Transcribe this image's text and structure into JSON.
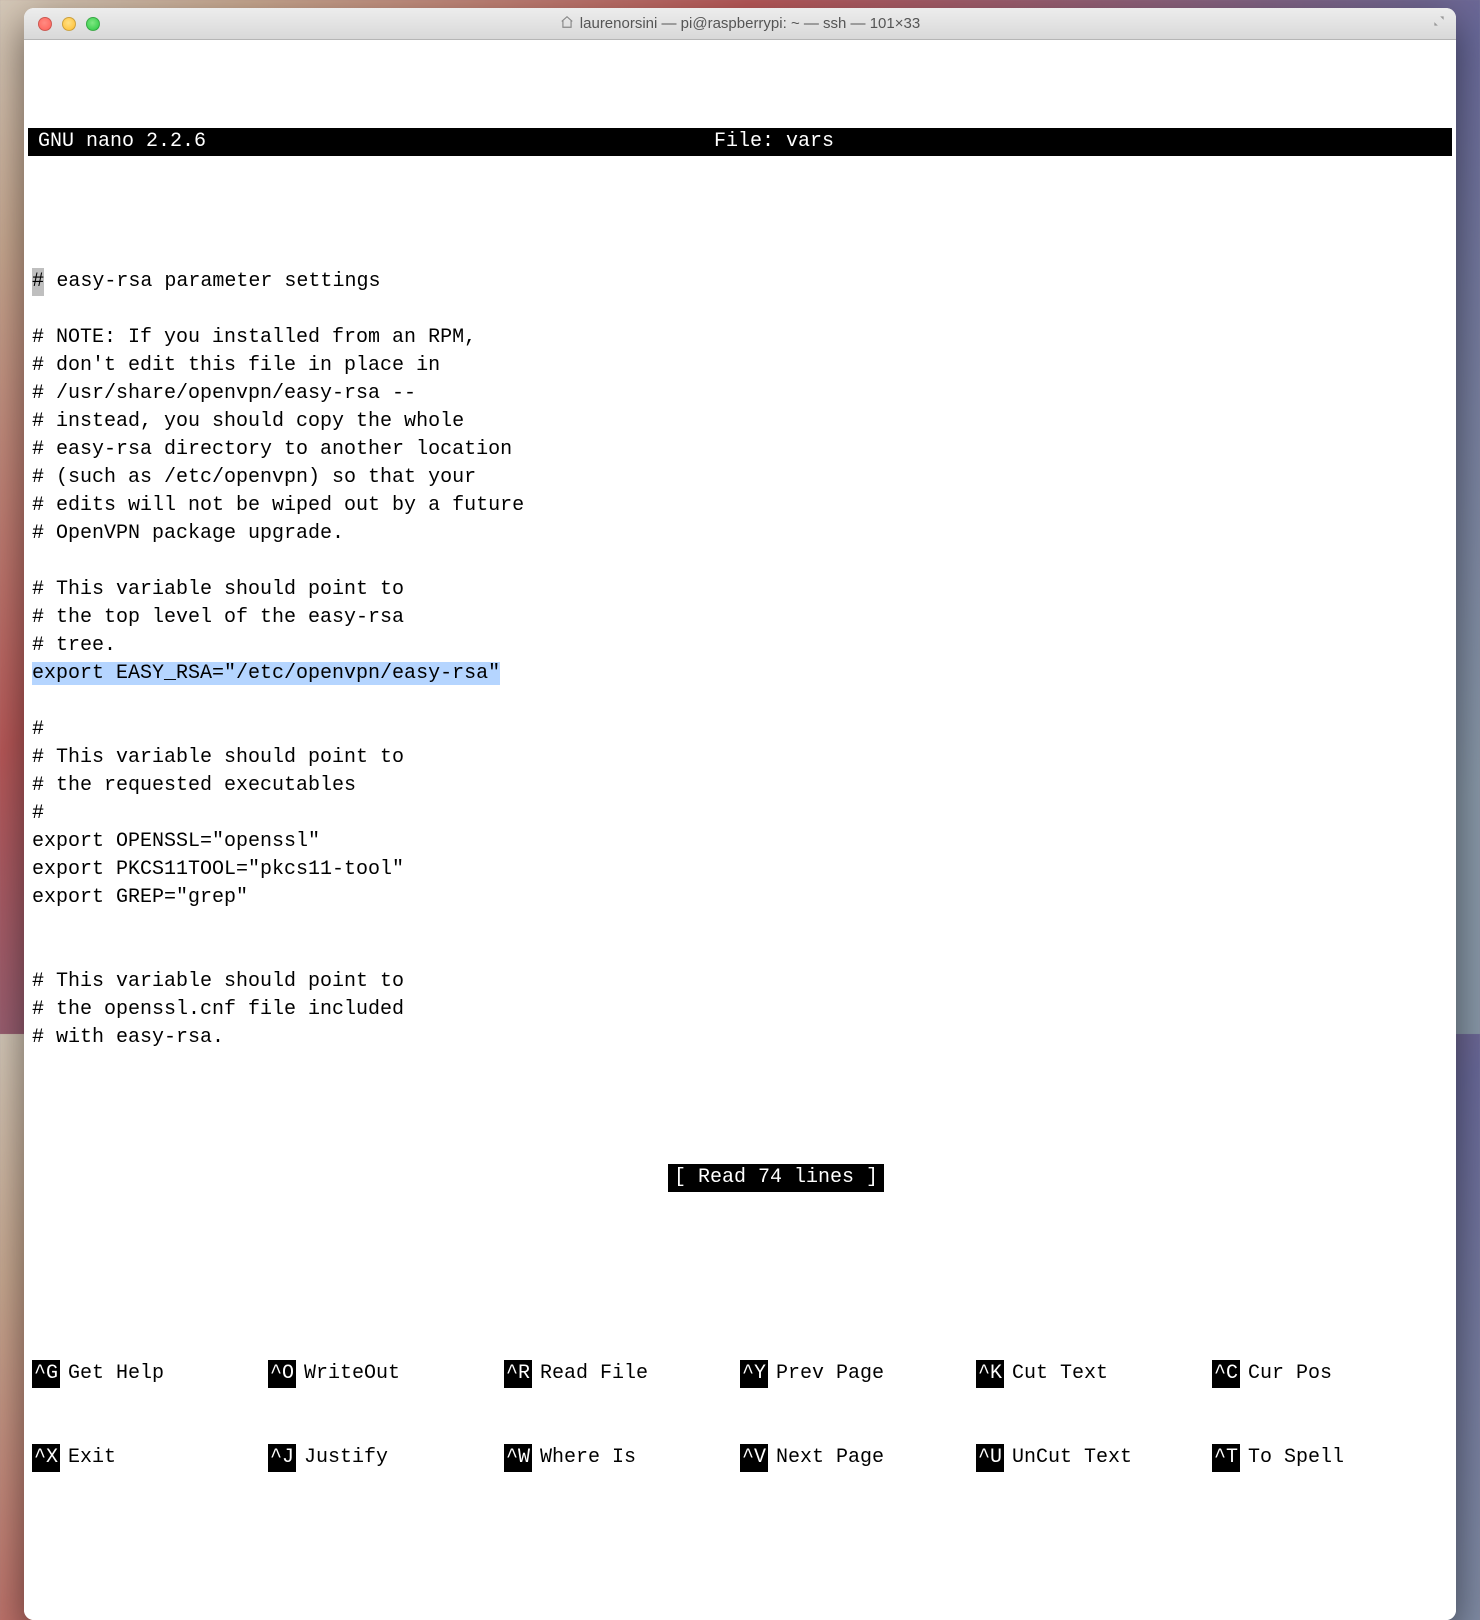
{
  "window": {
    "title": "laurenorsini — pi@raspberrypi: ~ — ssh — 101×33"
  },
  "nano": {
    "app": "GNU nano 2.2.6",
    "file_label": "File: vars",
    "status": "[ Read 74 lines ]"
  },
  "file": {
    "cursor_char": "#",
    "line01_rest": " easy-rsa parameter settings",
    "blank": "",
    "line03": "# NOTE: If you installed from an RPM,",
    "line04": "# don't edit this file in place in",
    "line05": "# /usr/share/openvpn/easy-rsa --",
    "line06": "# instead, you should copy the whole",
    "line07": "# easy-rsa directory to another location",
    "line08": "# (such as /etc/openvpn) so that your",
    "line09": "# edits will not be wiped out by a future",
    "line10": "# OpenVPN package upgrade.",
    "line12": "# This variable should point to",
    "line13": "# the top level of the easy-rsa",
    "line14": "# tree.",
    "line15_sel": "export EASY_RSA=\"/etc/openvpn/easy-rsa\"",
    "line17": "#",
    "line18": "# This variable should point to",
    "line19": "# the requested executables",
    "line20": "#",
    "line21": "export OPENSSL=\"openssl\"",
    "line22": "export PKCS11TOOL=\"pkcs11-tool\"",
    "line23": "export GREP=\"grep\"",
    "line26": "# This variable should point to",
    "line27": "# the openssl.cnf file included",
    "line28": "# with easy-rsa."
  },
  "shortcuts": {
    "row1": [
      {
        "key": "^G",
        "label": "Get Help"
      },
      {
        "key": "^O",
        "label": "WriteOut"
      },
      {
        "key": "^R",
        "label": "Read File"
      },
      {
        "key": "^Y",
        "label": "Prev Page"
      },
      {
        "key": "^K",
        "label": "Cut Text"
      },
      {
        "key": "^C",
        "label": "Cur Pos"
      }
    ],
    "row2": [
      {
        "key": "^X",
        "label": "Exit"
      },
      {
        "key": "^J",
        "label": "Justify"
      },
      {
        "key": "^W",
        "label": "Where Is"
      },
      {
        "key": "^V",
        "label": "Next Page"
      },
      {
        "key": "^U",
        "label": "UnCut Text"
      },
      {
        "key": "^T",
        "label": "To Spell"
      }
    ]
  }
}
